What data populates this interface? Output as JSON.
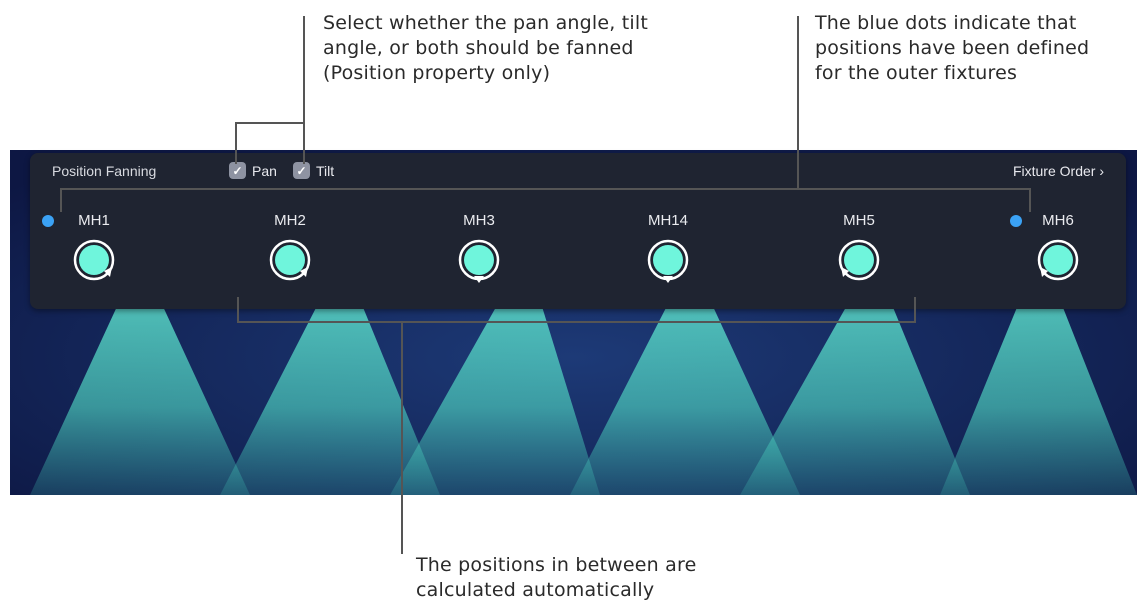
{
  "callouts": {
    "top_left": [
      "Select whether the pan angle, tilt",
      "angle, or both should be fanned",
      "(Position property only)"
    ],
    "top_right": [
      "The blue dots indicate that",
      "positions have been defined",
      "for the outer fixtures"
    ],
    "bottom": [
      "The positions in between are",
      "calculated automatically"
    ]
  },
  "panel": {
    "title": "Position Fanning",
    "pan": {
      "label": "Pan",
      "checked": true
    },
    "tilt": {
      "label": "Tilt",
      "checked": true
    },
    "fixture_order": "Fixture Order"
  },
  "fixtures": [
    {
      "name": "MH1",
      "has_position": true,
      "pointer": "right"
    },
    {
      "name": "MH2",
      "has_position": false,
      "pointer": "right"
    },
    {
      "name": "MH3",
      "has_position": false,
      "pointer": "bottom"
    },
    {
      "name": "MH14",
      "has_position": false,
      "pointer": "bottom"
    },
    {
      "name": "MH5",
      "has_position": false,
      "pointer": "left"
    },
    {
      "name": "MH6",
      "has_position": true,
      "pointer": "left"
    }
  ],
  "colors": {
    "beam": "#5fe4cf",
    "knob_fill": "#6ff5dc",
    "stage_bg": "#101c4a",
    "panel_bg": "#1f2431",
    "dot": "#3ba2f5"
  }
}
